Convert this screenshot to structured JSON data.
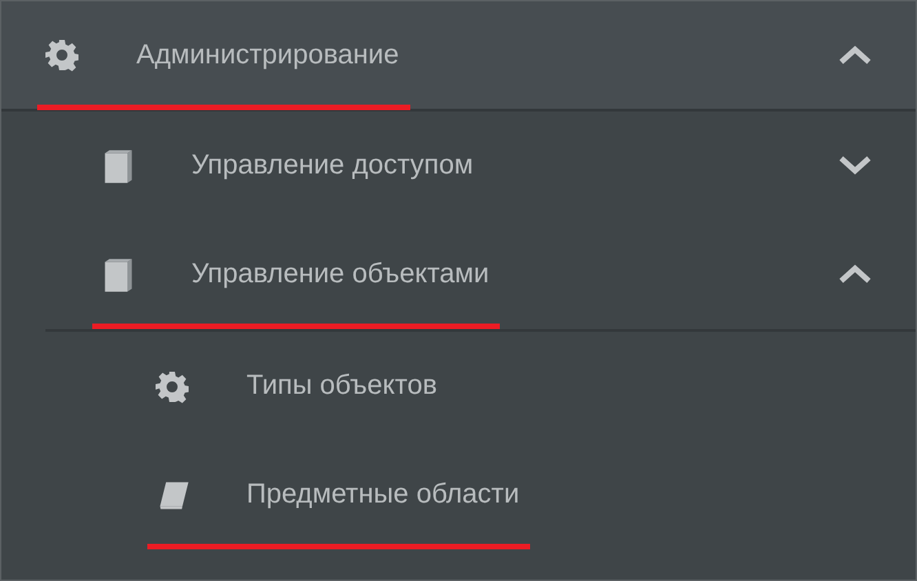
{
  "menu": [
    {
      "label": "Администрирование",
      "kind": "settings",
      "selected": true,
      "expanded": true,
      "children": [
        {
          "label": "Управление доступом",
          "kind": "group",
          "selected": false,
          "expanded": false
        },
        {
          "label": "Управление объектами",
          "kind": "group",
          "selected": true,
          "expanded": true,
          "children": [
            {
              "label": "Типы объектов",
              "kind": "settings",
              "selected": false
            },
            {
              "label": "Предметные области",
              "kind": "domain",
              "selected": true
            }
          ]
        }
      ]
    }
  ]
}
